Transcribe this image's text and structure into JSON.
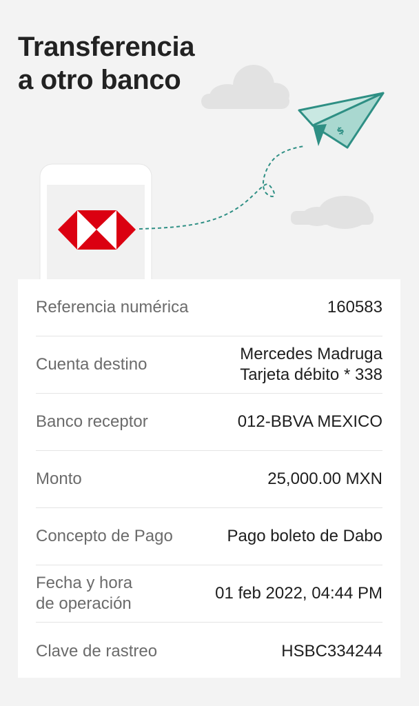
{
  "header": {
    "title_line1": "Transferencia",
    "title_line2": "a otro banco"
  },
  "illustration": {
    "icons": [
      "phone-icon",
      "hsbc-logo-icon",
      "paper-plane-icon",
      "cloud-icon"
    ],
    "colors": {
      "plane_fill": "#a9d8d0",
      "plane_stroke": "#2e8f84",
      "dashed_path": "#2e8f84",
      "cloud": "#e2e2e2",
      "hsbc_red": "#db0011"
    }
  },
  "details": {
    "reference": {
      "label": "Referencia numérica",
      "value": "160583"
    },
    "destination": {
      "label": "Cuenta destino",
      "value_line1": "Mercedes Madruga",
      "value_line2": "Tarjeta débito * 338"
    },
    "bank": {
      "label": "Banco receptor",
      "value": "012-BBVA MEXICO"
    },
    "amount": {
      "label": "Monto",
      "value": "25,000.00 MXN"
    },
    "concept": {
      "label": "Concepto de Pago",
      "value": "Pago boleto de Dabo"
    },
    "datetime": {
      "label_line1": "Fecha y hora",
      "label_line2": "de operación",
      "value": "01 feb 2022, 04:44 PM"
    },
    "tracking": {
      "label": "Clave de rastreo",
      "value": "HSBC334244"
    }
  }
}
